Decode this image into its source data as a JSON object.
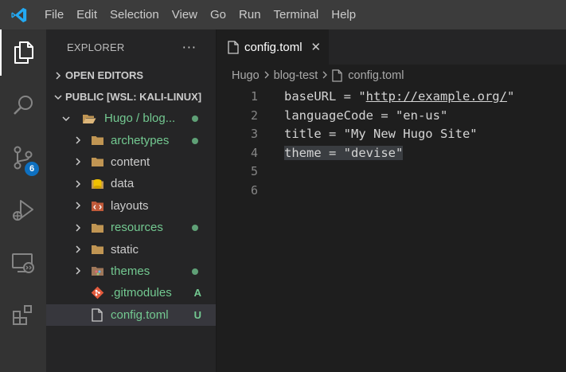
{
  "menu": [
    "File",
    "Edit",
    "Selection",
    "View",
    "Go",
    "Run",
    "Terminal",
    "Help"
  ],
  "activity": {
    "scm_badge": "6"
  },
  "sidebar": {
    "title": "EXPLORER",
    "more": "···",
    "open_editors": "OPEN EDITORS",
    "workspace": "PUBLIC [WSL: KALI-LINUX]",
    "root_folder": "Hugo / blog...",
    "items": [
      {
        "label": "archetypes",
        "status": "dot"
      },
      {
        "label": "content",
        "status": ""
      },
      {
        "label": "data",
        "status": ""
      },
      {
        "label": "layouts",
        "status": ""
      },
      {
        "label": "resources",
        "status": "dot"
      },
      {
        "label": "static",
        "status": ""
      },
      {
        "label": "themes",
        "status": "dot"
      },
      {
        "label": ".gitmodules",
        "status": "A"
      },
      {
        "label": "config.toml",
        "status": "U"
      }
    ]
  },
  "editor": {
    "tab": {
      "label": "config.toml",
      "close": "✕"
    },
    "breadcrumb": [
      "Hugo",
      "blog-test",
      "config.toml"
    ],
    "lines": [
      {
        "num": "1",
        "before": "baseURL = \"",
        "url": "http://example.org/",
        "after": "\""
      },
      {
        "num": "2",
        "text": "languageCode = \"en-us\""
      },
      {
        "num": "3",
        "text": "title = \"My New Hugo Site\""
      },
      {
        "num": "4",
        "text": "theme = \"devise\""
      },
      {
        "num": "5",
        "text": ""
      },
      {
        "num": "6",
        "text": ""
      }
    ]
  },
  "colors": {
    "git_green": "#73c991",
    "badge_blue": "#0e70c0",
    "folder": "#c09553"
  }
}
